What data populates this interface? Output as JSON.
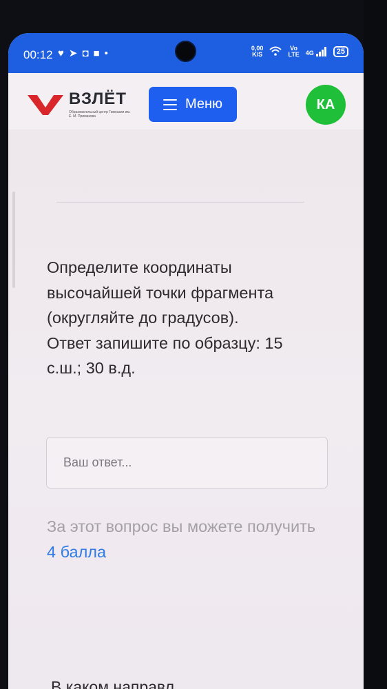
{
  "status_bar": {
    "time": "00:12",
    "net_speed_value": "0,00",
    "net_speed_unit": "K/S",
    "volte": "Vo",
    "lte": "LTE",
    "network": "4G",
    "battery": "25"
  },
  "header": {
    "logo_title": "ВЗЛЁТ",
    "logo_subtitle": "Образовательный центр Гимназии им. Е. М. Примакова",
    "menu_label": "Меню",
    "avatar_initials": "КА"
  },
  "question": {
    "text_line1": "Определите координаты",
    "text_line2": "высочайшей точки фрагмента",
    "text_line3": "(округляйте до градусов).",
    "text_line4": "Ответ запишите по образцу: 15",
    "text_line5": "с.ш.; 30 в.д.",
    "answer_placeholder": "Ваш ответ...",
    "answer_value": "",
    "points_prefix": "За этот вопрос вы можете получить",
    "points_link": "4 балла"
  },
  "next_question_partial": "В каком направл",
  "colors": {
    "accent": "#1f5ff0",
    "avatar": "#1fbf3a",
    "link": "#2f7de4",
    "logo_red": "#d8262a"
  },
  "icons": [
    "heart-icon",
    "telegram-icon",
    "app-icon",
    "square-icon",
    "dot-icon",
    "wifi-icon",
    "signal-icon",
    "hamburger-icon"
  ]
}
